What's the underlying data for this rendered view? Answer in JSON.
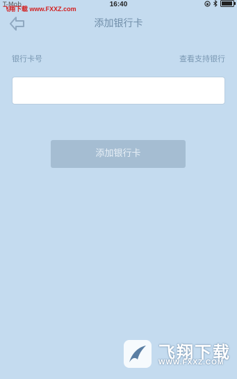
{
  "status_bar": {
    "carrier": "T-Mob",
    "watermark": "飞翔下载 www.FXXZ.com",
    "time": "16:40"
  },
  "nav": {
    "title": "添加银行卡"
  },
  "form": {
    "card_label": "银行卡号",
    "supported_banks_link": "查看支持银行",
    "card_input_value": "",
    "submit_label": "添加银行卡"
  },
  "watermark_logo": {
    "name": "飞翔下载",
    "url": "WWW.FXXZ.COM"
  }
}
